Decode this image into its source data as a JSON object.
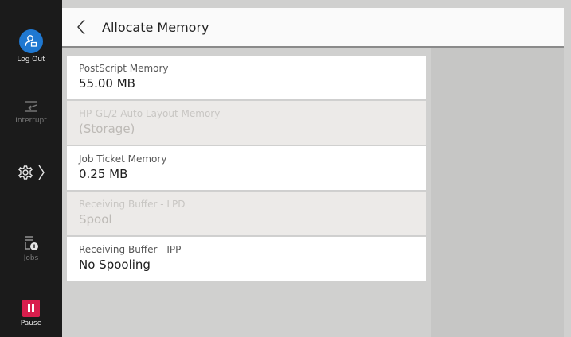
{
  "sidebar": {
    "logout_label": "Log Out",
    "interrupt_label": "Interrupt",
    "jobs_label": "Jobs",
    "pause_label": "Pause"
  },
  "header": {
    "title": "Allocate Memory"
  },
  "settings": [
    {
      "label": "PostScript Memory",
      "value": "55.00 MB",
      "enabled": true
    },
    {
      "label": "HP-GL/2 Auto Layout Memory",
      "value": "(Storage)",
      "enabled": false
    },
    {
      "label": "Job Ticket Memory",
      "value": "0.25 MB",
      "enabled": true
    },
    {
      "label": "Receiving Buffer - LPD",
      "value": "Spool",
      "enabled": false
    },
    {
      "label": "Receiving Buffer - IPP",
      "value": "No Spooling",
      "enabled": true
    }
  ],
  "colors": {
    "accent_blue": "#1f78d1",
    "pause_red": "#d81e4d",
    "rail_bg": "#1b1b1b"
  }
}
